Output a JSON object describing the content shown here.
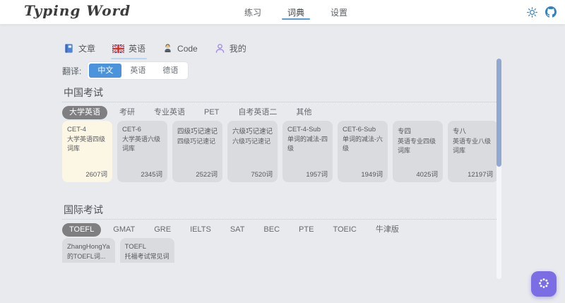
{
  "header": {
    "logo": "Typing Word",
    "nav": [
      {
        "label": "练习",
        "active": false
      },
      {
        "label": "词典",
        "active": true
      },
      {
        "label": "设置",
        "active": false
      }
    ],
    "icons": {
      "theme": "sun-icon",
      "repo": "github-icon"
    }
  },
  "tabs": [
    {
      "label": "文章",
      "icon": "book-icon",
      "active": false
    },
    {
      "label": "英语",
      "icon": "uk-flag-icon",
      "active": true
    },
    {
      "label": "Code",
      "icon": "technologist-icon",
      "active": false
    },
    {
      "label": "我的",
      "icon": "person-icon",
      "active": false
    }
  ],
  "translate": {
    "label": "翻译:",
    "options": [
      {
        "label": "中文",
        "selected": true
      },
      {
        "label": "英语",
        "selected": false
      },
      {
        "label": "德语",
        "selected": false
      }
    ]
  },
  "sections": [
    {
      "title": "中国考试",
      "chips": [
        {
          "label": "大学英语",
          "selected": true
        },
        {
          "label": "考研",
          "selected": false
        },
        {
          "label": "专业英语",
          "selected": false
        },
        {
          "label": "PET",
          "selected": false
        },
        {
          "label": "自考英语二",
          "selected": false
        },
        {
          "label": "其他",
          "selected": false
        }
      ],
      "cards": [
        {
          "name": "CET-4",
          "desc": "大学英语四级词库",
          "count": "2607词",
          "selected": true
        },
        {
          "name": "CET-6",
          "desc": "大学英语六级词库",
          "count": "2345词",
          "selected": false
        },
        {
          "name": "四级巧记速记",
          "desc": "四级巧记速记",
          "count": "2522词",
          "selected": false
        },
        {
          "name": "六级巧记速记",
          "desc": "六级巧记速记",
          "count": "7520词",
          "selected": false
        },
        {
          "name": "CET-4-Sub",
          "desc": "单词的减法-四级",
          "count": "1957词",
          "selected": false
        },
        {
          "name": "CET-6-Sub",
          "desc": "单词的减法-六级",
          "count": "1949词",
          "selected": false
        },
        {
          "name": "专四",
          "desc": "英语专业四级词库",
          "count": "4025词",
          "selected": false
        },
        {
          "name": "专八",
          "desc": "英语专业八级词库",
          "count": "12197词",
          "selected": false
        }
      ]
    },
    {
      "title": "国际考试",
      "chips": [
        {
          "label": "TOEFL",
          "selected": true
        },
        {
          "label": "GMAT",
          "selected": false
        },
        {
          "label": "GRE",
          "selected": false
        },
        {
          "label": "IELTS",
          "selected": false
        },
        {
          "label": "SAT",
          "selected": false
        },
        {
          "label": "BEC",
          "selected": false
        },
        {
          "label": "PTE",
          "selected": false
        },
        {
          "label": "TOEIC",
          "selected": false
        },
        {
          "label": "牛津版",
          "selected": false
        }
      ],
      "cards": [
        {
          "name": "ZhangHongYa",
          "desc": "的TOEFL词...",
          "count": "",
          "selected": false
        },
        {
          "name": "TOEFL",
          "desc": "托福考试常见词",
          "count": "",
          "selected": false
        }
      ]
    }
  ],
  "fab": {
    "icon": "dots-ring-icon"
  },
  "colors": {
    "page_bg": "#e8eaed",
    "header_bg": "#ffffff",
    "accent_blue": "#4b94dc",
    "nav_underline": "#579dd9",
    "tab_underline": "#b9d6f1",
    "icon_blue": "#2f81c4",
    "chip_selected_bg": "#7f7f82",
    "card_bg": "#d9dbde",
    "card_selected_bg": "#fcf6e5",
    "scrollbar_thumb": "#91a9d1",
    "fab_bg": "#7b6de3"
  }
}
